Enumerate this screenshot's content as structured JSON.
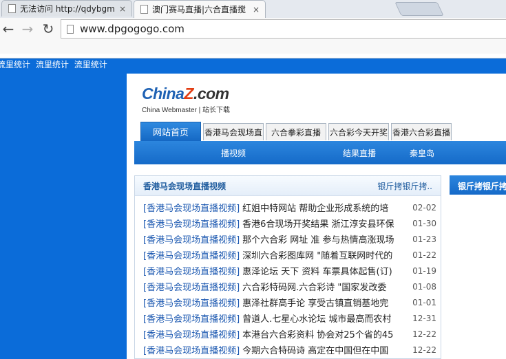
{
  "browser": {
    "tabs": [
      {
        "title": "无法访问 http://qdybgm",
        "close": "×",
        "active": false
      },
      {
        "title": "澳门赛马直播|六合直播搅",
        "close": "×",
        "active": true
      }
    ],
    "nav": {
      "back": "←",
      "forward": "→",
      "reload": "↻"
    },
    "address": "www.dpgogogo.com"
  },
  "page": {
    "stats_links": [
      "流里统计",
      "流里统计",
      "流里统计"
    ],
    "logo": {
      "brand_a": "China",
      "brand_z": "Z",
      "brand_b": ".com",
      "subtitle": "China Webmaster | 站长下载"
    },
    "menu": [
      {
        "label": "网站首页",
        "active": true
      },
      {
        "label": "香港马会现场直",
        "active": false
      },
      {
        "label": "六合拳彩直播",
        "active": false
      },
      {
        "label": "六合彩今天开奖",
        "active": false
      },
      {
        "label": "香港六合彩直播",
        "active": false
      }
    ],
    "subnav": [
      "播视频",
      "结果直播",
      "秦皇岛"
    ],
    "panel": {
      "title": "香港马会现场直播视频",
      "more": "银斤拷银斤拷..",
      "items": [
        {
          "cat": "[香港马会现场直播视频]",
          "text": "红姐中特网站 帮助企业形成系统的培",
          "date": "02-02"
        },
        {
          "cat": "[香港马会现场直播视频]",
          "text": "香港6合现场开奖结果 浙江淳安县环保",
          "date": "01-30"
        },
        {
          "cat": "[香港马会现场直播视频]",
          "text": "那个六合彩 网址 准 参与热情高涨现场",
          "date": "01-23"
        },
        {
          "cat": "[香港马会现场直播视频]",
          "text": "深圳六合彩图库网 \"随着互联网时代的",
          "date": "01-22"
        },
        {
          "cat": "[香港马会现场直播视频]",
          "text": "惠泽论坛 天下 资料 车票具体起售(订)",
          "date": "01-19"
        },
        {
          "cat": "[香港马会现场直播视频]",
          "text": "六合彩特码网.六合彩诗 \"国家发改委",
          "date": "01-08"
        },
        {
          "cat": "[香港马会现场直播视频]",
          "text": "惠泽社群高手论 享受古镇直销基地完",
          "date": "01-01"
        },
        {
          "cat": "[香港马会现场直播视频]",
          "text": "曾道人.七星心水论坛 城市最高而农村",
          "date": "12-31"
        },
        {
          "cat": "[香港马会现场直播视频]",
          "text": "本港台六合彩资料 协会对25个省的45",
          "date": "12-22"
        },
        {
          "cat": "[香港马会现场直播视频]",
          "text": "今期六合特码诗 高定在中国但在中国",
          "date": "12-22"
        }
      ]
    },
    "side_title": "银斤拷银斤拷银"
  }
}
